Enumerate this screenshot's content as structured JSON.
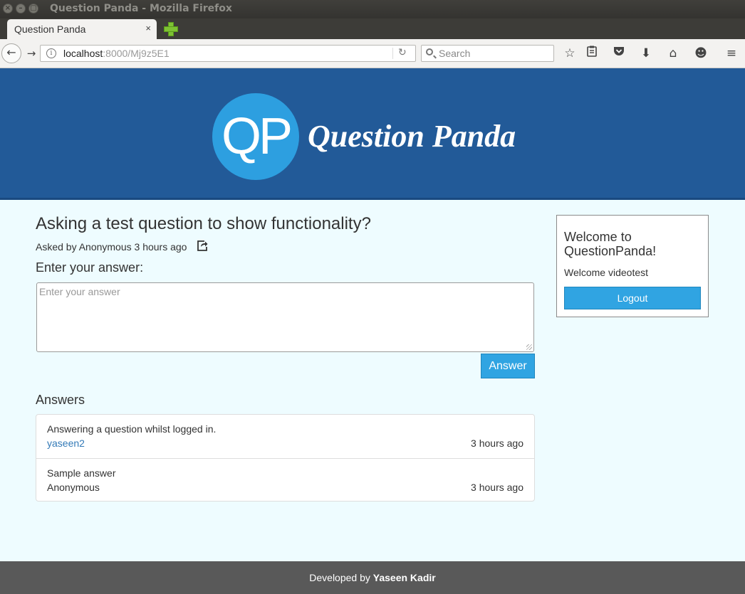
{
  "window": {
    "title": "Question Panda - Mozilla Firefox",
    "controls": {
      "close": "×",
      "minimize": "–",
      "maximize": "▢"
    }
  },
  "browser": {
    "tab_title": "Question Panda",
    "tab_close": "×",
    "url_host": "localhost",
    "url_rest": ":8000/Mj9z5E1",
    "search_placeholder": "Search",
    "icons": {
      "back": "back-arrow-icon",
      "forward": "forward-arrow-icon",
      "reload": "reload-icon",
      "bookmark": "star-icon",
      "reading_list": "clipboard-icon",
      "pocket": "pocket-icon",
      "downloads": "download-arrow-icon",
      "home": "home-icon",
      "hello": "smiley-icon",
      "menu": "hamburger-menu-icon"
    }
  },
  "header": {
    "logo_letters": "QP",
    "logo_name": "Question Panda"
  },
  "question": {
    "title": "Asking a test question to show functionality?",
    "meta": "Asked by Anonymous 3 hours ago"
  },
  "answer_form": {
    "label": "Enter your answer:",
    "placeholder": "Enter your answer",
    "submit_label": "Answer"
  },
  "answers": {
    "heading": "Answers",
    "items": [
      {
        "text": "Answering a question whilst logged in.",
        "author": "yaseen2",
        "time": "3 hours ago"
      },
      {
        "text": "Sample answer",
        "author": "Anonymous",
        "time": "3 hours ago"
      }
    ]
  },
  "sidebar": {
    "title": "Welcome to QuestionPanda!",
    "welcome": "Welcome videotest",
    "logout_label": "Logout"
  },
  "footer": {
    "prefix": "Developed by",
    "author": "Yaseen Kadir"
  },
  "colors": {
    "banner": "#225a98",
    "logo_circle": "#2d9fe0",
    "button": "#30a4e2",
    "page_bg": "#eefcff",
    "footer": "#595959",
    "link": "#337ab7"
  }
}
